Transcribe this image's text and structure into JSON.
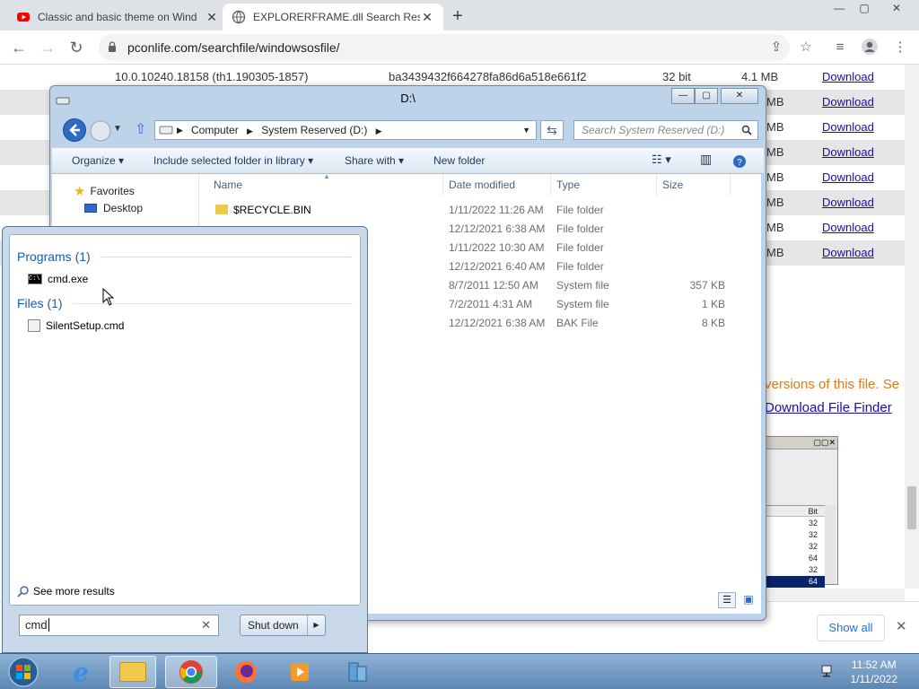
{
  "browser": {
    "tabs": [
      {
        "title": "Classic and basic theme on Wind",
        "close": "✕"
      },
      {
        "title": "EXPLORERFRAME.dll Search Resu",
        "close": "✕"
      }
    ],
    "new_tab": "+",
    "url": "pconlife.com/searchfile/windowsosfile/",
    "window_controls": {
      "minimize": "—",
      "maximize": "▢",
      "close": "✕"
    }
  },
  "webpage": {
    "top_row": {
      "version": "10.0.10240.18158 (th1.190305-1857)",
      "hash": "ba3439432f664278fa86d6a518e661f2",
      "bits": "32 bit",
      "size": "4.1 MB",
      "download": "Download"
    },
    "rows": [
      {
        "size": "MB",
        "download": "Download"
      },
      {
        "size": "MB",
        "download": "Download"
      },
      {
        "size": "MB",
        "download": "Download"
      },
      {
        "size": "MB",
        "download": "Download"
      },
      {
        "size": "MB",
        "download": "Download"
      },
      {
        "size": "MB",
        "download": "Download"
      },
      {
        "size": "MB",
        "download": "Download"
      }
    ],
    "orange_text": "versions of this file. Se",
    "finder_link": "Download File Finder",
    "mini_bit_header": "Bit",
    "mini_bits": [
      "32",
      "32",
      "32",
      "64",
      "32",
      "64"
    ],
    "show_all": "Show all",
    "close_bar": "✕"
  },
  "explorer": {
    "title": "D:\\",
    "breadcrumb": [
      "Computer",
      "System Reserved (D:)"
    ],
    "search_placeholder": "Search System Reserved (D:)",
    "commands": [
      "Organize",
      "Include selected folder in library",
      "Share with",
      "New folder"
    ],
    "nav": {
      "favorites": "Favorites",
      "desktop": "Desktop"
    },
    "columns": [
      "Name",
      "Date modified",
      "Type",
      "Size"
    ],
    "files": [
      {
        "name": "$RECYCLE.BIN",
        "date": "1/11/2022 11:26 AM",
        "type": "File folder",
        "size": ""
      },
      {
        "name": "",
        "date": "12/12/2021 6:38 AM",
        "type": "File folder",
        "size": ""
      },
      {
        "name": "",
        "date": "1/11/2022 10:30 AM",
        "type": "File folder",
        "size": ""
      },
      {
        "name": "",
        "date": "12/12/2021 6:40 AM",
        "type": "File folder",
        "size": ""
      },
      {
        "name": "",
        "date": "8/7/2011 12:50 AM",
        "type": "System file",
        "size": "357 KB"
      },
      {
        "name": "",
        "date": "7/2/2011 4:31 AM",
        "type": "System file",
        "size": "1 KB"
      },
      {
        "name": "",
        "date": "12/12/2021 6:38 AM",
        "type": "BAK File",
        "size": "8 KB"
      }
    ]
  },
  "start_menu": {
    "programs_header": "Programs (1)",
    "program_item": "cmd.exe",
    "files_header": "Files (1)",
    "file_item": "SilentSetup.cmd",
    "see_more": "See more results",
    "search_value": "cmd",
    "shutdown": "Shut down"
  },
  "taskbar": {
    "time": "11:52 AM",
    "date": "1/11/2022"
  }
}
